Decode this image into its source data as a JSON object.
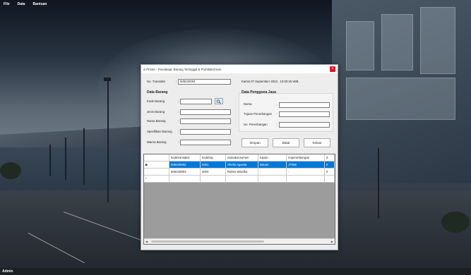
{
  "menu": {
    "items": [
      "File",
      "Data",
      "Bantuan"
    ]
  },
  "status": {
    "user": "Admin"
  },
  "window": {
    "title": "si Printer - Pendataan Barang Tertinggal & Prohibited Item",
    "close_glyph": "×",
    "no_transaksi_label": "No. Transaksi",
    "no_transaksi_value": "509230004",
    "datetime": "Kamis 07 September 2023 , 10:00:26 WIB",
    "data_barang_header": "Data Barang",
    "kode_barang_label": "Kode Barang",
    "kode_barang_value": "",
    "jenis_barang_label": "Jenis Barang",
    "jenis_barang_value": "",
    "nama_barang_label": "Nama Barang",
    "nama_barang_value": "",
    "spesifikasi_label": "Spesifikasi Barang",
    "spesifikasi_value": "",
    "warna_label": "Warna Barang",
    "warna_value": "",
    "pengguna_header": "Data Pengguna Jasa",
    "nama_label": "Nama",
    "nama_value": "",
    "tujuan_label": "Tujuan Penerbangan",
    "tujuan_value": "",
    "no_penerbangan_label": "No. Penerbangan",
    "no_penerbangan_value": "",
    "colon": ":",
    "buttons": {
      "simpan": "Simpan",
      "batal": "Batal",
      "keluar": "Keluar"
    }
  },
  "grid": {
    "columns": [
      "kodetransaksi",
      "kodebrg",
      "namakonsumen",
      "tujuan",
      "nopenerbangan",
      "d"
    ],
    "rows": [
      {
        "marker": "▶",
        "cells": [
          "509230002",
          "0001",
          "Sheila Agustia",
          "Batam",
          "JT098",
          "0"
        ]
      },
      {
        "marker": "",
        "cells": [
          "509230003",
          "0004",
          "Rahmi Wardha",
          "-",
          "-",
          "0"
        ]
      },
      {
        "marker": "*",
        "cells": [
          "",
          "",
          "",
          "",
          "",
          ""
        ]
      }
    ]
  },
  "colors": {
    "selection": "#0078d7",
    "close": "#e81123"
  },
  "icons": {
    "search": "search-icon"
  }
}
